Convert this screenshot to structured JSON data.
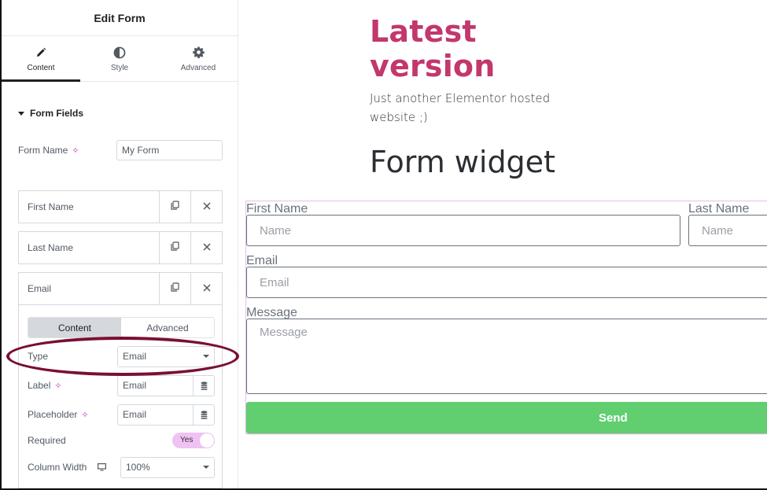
{
  "panel": {
    "title": "Edit Form",
    "tabs": [
      {
        "label": "Content",
        "icon": "pencil-icon",
        "active": true
      },
      {
        "label": "Style",
        "icon": "half-circle-icon",
        "active": false
      },
      {
        "label": "Advanced",
        "icon": "gear-icon",
        "active": false
      }
    ],
    "section_title": "Form Fields",
    "form_name": {
      "label": "Form Name",
      "value": "My Form"
    },
    "fields": [
      {
        "title": "First Name"
      },
      {
        "title": "Last Name"
      },
      {
        "title": "Email"
      }
    ],
    "field_editor": {
      "tabs": [
        {
          "label": "Content",
          "active": true
        },
        {
          "label": "Advanced",
          "active": false
        }
      ],
      "type": {
        "label": "Type",
        "value": "Email"
      },
      "label": {
        "label": "Label",
        "value": "Email"
      },
      "placeholder": {
        "label": "Placeholder",
        "value": "Email"
      },
      "required": {
        "label": "Required",
        "value": "Yes",
        "on": true
      },
      "column_width": {
        "label": "Column Width",
        "value": "100%"
      }
    },
    "accent_color": "#c036c0",
    "highlight_color": "#7a0f35"
  },
  "preview": {
    "site_title_line1": "Latest",
    "site_title_line2": "version",
    "tagline": "Just another Elementor hosted website ;)",
    "widget_title": "Form widget",
    "form": {
      "first_name": {
        "label": "First Name",
        "placeholder": "Name"
      },
      "last_name": {
        "label": "Last Name",
        "placeholder": "Name"
      },
      "email": {
        "label": "Email",
        "placeholder": "Email"
      },
      "message": {
        "label": "Message",
        "placeholder": "Message"
      },
      "submit_label": "Send"
    },
    "title_color": "#c2376c",
    "button_color": "#61ce70"
  }
}
